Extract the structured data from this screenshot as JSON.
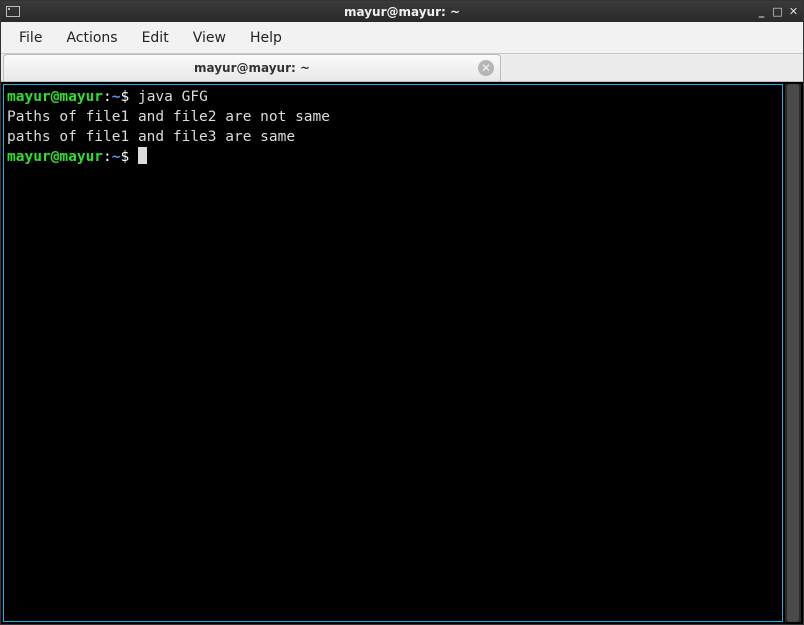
{
  "titlebar": {
    "title": "mayur@mayur: ~"
  },
  "menubar": {
    "items": [
      "File",
      "Actions",
      "Edit",
      "View",
      "Help"
    ]
  },
  "tab": {
    "label": "mayur@mayur: ~"
  },
  "terminal": {
    "lines": [
      {
        "type": "prompt",
        "user": "mayur@mayur",
        "sep1": ":",
        "path": "~",
        "sep2": "$ ",
        "cmd": "java GFG"
      },
      {
        "type": "output",
        "text": "Paths of file1 and file2 are not same"
      },
      {
        "type": "output",
        "text": "paths of file1 and file3 are same"
      },
      {
        "type": "prompt",
        "user": "mayur@mayur",
        "sep1": ":",
        "path": "~",
        "sep2": "$ ",
        "cmd": "",
        "cursor": true
      }
    ]
  },
  "colors": {
    "prompt_user": "#2de02d",
    "prompt_path": "#4aa0ff",
    "terminal_bg": "#000000",
    "terminal_border": "#1db0e6"
  }
}
